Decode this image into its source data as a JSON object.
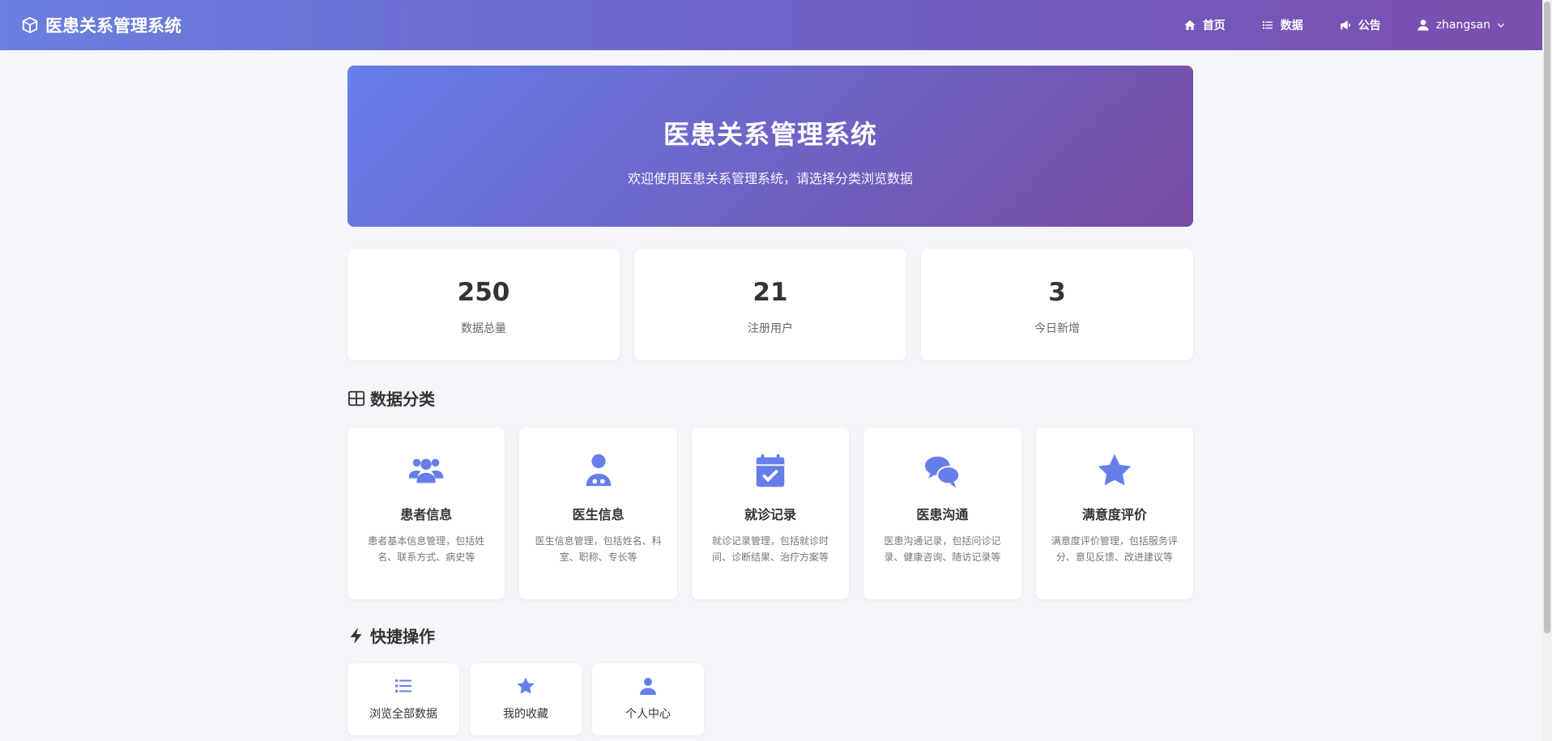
{
  "navbar": {
    "brand": "医患关系管理系统",
    "brand_icon": "cube-icon",
    "links": [
      {
        "label": "首页",
        "icon": "home-icon"
      },
      {
        "label": "数据",
        "icon": "list-icon"
      },
      {
        "label": "公告",
        "icon": "megaphone-icon"
      }
    ],
    "user": {
      "name": "zhangsan",
      "icon": "user-icon"
    }
  },
  "hero": {
    "title": "医患关系管理系统",
    "subtitle": "欢迎使用医患关系管理系统，请选择分类浏览数据"
  },
  "stats": [
    {
      "value": "250",
      "label": "数据总量"
    },
    {
      "value": "21",
      "label": "注册用户"
    },
    {
      "value": "3",
      "label": "今日新增"
    }
  ],
  "categories_section": {
    "title": "数据分类",
    "items": [
      {
        "title": "患者信息",
        "desc": "患者基本信息管理，包括姓名、联系方式、病史等",
        "icon": "users-icon"
      },
      {
        "title": "医生信息",
        "desc": "医生信息管理，包括姓名、科室、职称、专长等",
        "icon": "doctor-icon"
      },
      {
        "title": "就诊记录",
        "desc": "就诊记录管理，包括就诊时间、诊断结果、治疗方案等",
        "icon": "calendar-check-icon"
      },
      {
        "title": "医患沟通",
        "desc": "医患沟通记录，包括问诊记录、健康咨询、随访记录等",
        "icon": "comments-icon"
      },
      {
        "title": "满意度评价",
        "desc": "满意度评价管理，包括服务评分、意见反馈、改进建议等",
        "icon": "star-icon"
      }
    ]
  },
  "quick_section": {
    "title": "快捷操作",
    "items": [
      {
        "label": "浏览全部数据",
        "icon": "list-icon"
      },
      {
        "label": "我的收藏",
        "icon": "star-icon"
      },
      {
        "label": "个人中心",
        "icon": "user-icon"
      }
    ]
  },
  "colors": {
    "accent": "#667eea",
    "accent_end": "#764ba2"
  }
}
